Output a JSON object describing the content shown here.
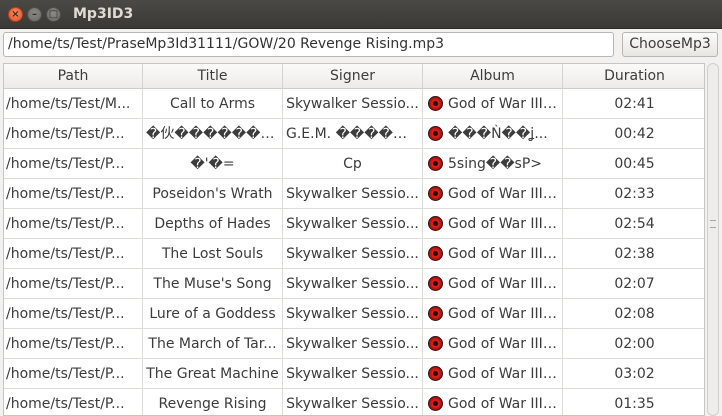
{
  "window": {
    "title": "Mp3ID3"
  },
  "controls": {
    "close_icon": "×",
    "minimize_icon": "–",
    "maximize_icon": "□"
  },
  "path_input": {
    "value": "/home/ts/Test/PraseMp3Id31111/GOW/20 Revenge Rising.mp3"
  },
  "choose_button": {
    "label": "ChooseMp3"
  },
  "table": {
    "columns": [
      "Path",
      "Title",
      "Signer",
      "Album",
      "Duration"
    ],
    "rows": [
      {
        "path": "/home/ts/Test/M...",
        "title": "Call to Arms",
        "signer": "Skywalker Sessio...",
        "album": "God of War III ...",
        "duration": "02:41"
      },
      {
        "path": "/home/ts/Test/P...",
        "title": "�伙�������...",
        "signer": "G.E.M. ������",
        "album": "���Ǹ��ʝ...",
        "duration": "00:42"
      },
      {
        "path": "/home/ts/Test/P...",
        "title": "�'�=",
        "signer": "Cp",
        "album": "5sing��sP>",
        "duration": "00:45"
      },
      {
        "path": "/home/ts/Test/P...",
        "title": "Poseidon's Wrath",
        "signer": "Skywalker Sessio...",
        "album": "God of War III ...",
        "duration": "02:33"
      },
      {
        "path": "/home/ts/Test/P...",
        "title": "Depths of Hades",
        "signer": "Skywalker Sessio...",
        "album": "God of War III ...",
        "duration": "02:54"
      },
      {
        "path": "/home/ts/Test/P...",
        "title": "The Lost Souls",
        "signer": "Skywalker Sessio...",
        "album": "God of War III ...",
        "duration": "02:38"
      },
      {
        "path": "/home/ts/Test/P...",
        "title": "The Muse's Song",
        "signer": "Skywalker Sessio...",
        "album": "God of War III ...",
        "duration": "02:07"
      },
      {
        "path": "/home/ts/Test/P...",
        "title": "Lure of a Goddess",
        "signer": "Skywalker Sessio...",
        "album": "God of War III ...",
        "duration": "02:08"
      },
      {
        "path": "/home/ts/Test/P...",
        "title": "The March of Tar...",
        "signer": "Skywalker Sessio...",
        "album": "God of War III ...",
        "duration": "02:00"
      },
      {
        "path": "/home/ts/Test/P...",
        "title": "The Great Machine",
        "signer": "Skywalker Sessio...",
        "album": "God of War III ...",
        "duration": "03:02"
      },
      {
        "path": "/home/ts/Test/P...",
        "title": "Revenge Rising",
        "signer": "Skywalker Sessio...",
        "album": "God of War III ...",
        "duration": "01:35"
      }
    ]
  }
}
